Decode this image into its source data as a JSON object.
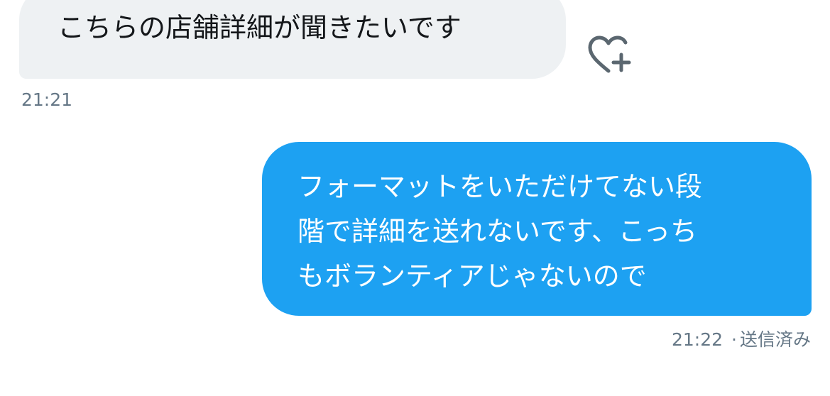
{
  "conversation": {
    "incoming": {
      "text": "こちらの店舗詳細が聞きたいです",
      "timestamp": "21:21",
      "reaction_icon": "heart-plus-icon"
    },
    "outgoing": {
      "lines": [
        "フォーマットをいただけてない段",
        "階で詳細を送れないです、こっち",
        "もボランティアじゃないので"
      ],
      "timestamp": "21:22",
      "separator": "·",
      "status": "送信済み"
    }
  },
  "colors": {
    "incoming_bubble": "#eef1f3",
    "outgoing_bubble": "#1da1f2",
    "meta_text": "#657786",
    "icon": "#5b6770"
  }
}
